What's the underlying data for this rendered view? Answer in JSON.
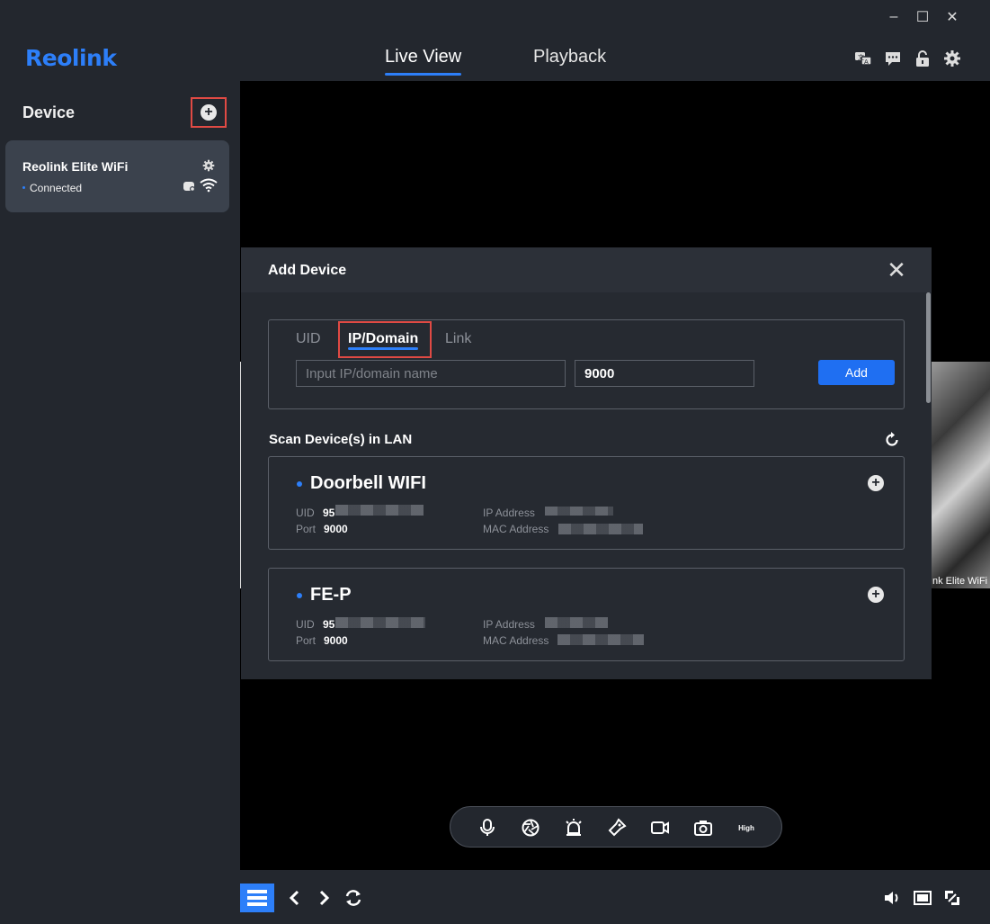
{
  "app": {
    "brand": "Reolink",
    "accent": "#2d7ff9"
  },
  "window_controls": {
    "minimize": "–",
    "maximize": "☐",
    "close": "✕"
  },
  "nav": {
    "tabs": [
      {
        "label": "Live View",
        "active": true
      },
      {
        "label": "Playback",
        "active": false
      }
    ]
  },
  "top_icons": [
    "translate-icon",
    "chat-icon",
    "lock-icon",
    "gear-icon"
  ],
  "sidebar": {
    "title": "Device",
    "add_icon": "+",
    "devices": [
      {
        "name": "Reolink Elite WiFi",
        "status": "Connected"
      }
    ]
  },
  "camera": {
    "label": "nk Elite WiFi"
  },
  "modal": {
    "title": "Add Device",
    "close": "✕",
    "tabs": [
      "UID",
      "IP/Domain",
      "Link"
    ],
    "active_tab": "IP/Domain",
    "ip_placeholder": "Input IP/domain name",
    "port_value": "9000",
    "add_label": "Add",
    "scan_title": "Scan Device(s) in LAN",
    "scanned": [
      {
        "name": "Doorbell WIFI",
        "uid_label": "UID",
        "uid_prefix": "95",
        "port_label": "Port",
        "port": "9000",
        "ip_label": "IP Address",
        "mac_label": "MAC Address"
      },
      {
        "name": "FE-P",
        "uid_label": "UID",
        "uid_prefix": "95",
        "port_label": "Port",
        "port": "9000",
        "ip_label": "IP Address",
        "mac_label": "MAC Address"
      }
    ]
  },
  "controls": {
    "quality_label": "High"
  }
}
